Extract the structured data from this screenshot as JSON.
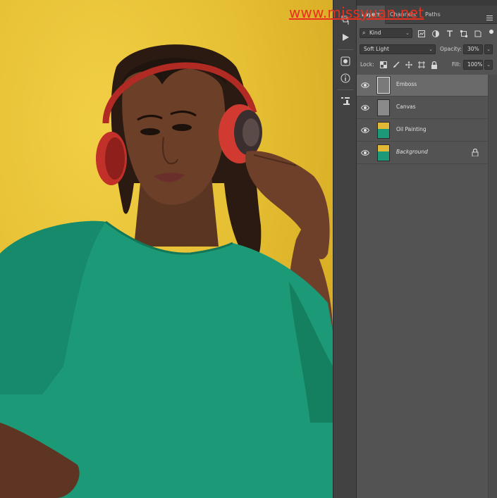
{
  "watermark": "www.missyuan.net",
  "tabs": {
    "layers": "Layers",
    "channels": "Channels",
    "paths": "Paths"
  },
  "filter": {
    "kind_label": "Kind"
  },
  "blend": {
    "mode": "Soft Light",
    "opacity_label": "Opacity:",
    "opacity_value": "30%"
  },
  "lock": {
    "label": "Lock:",
    "fill_label": "Fill:",
    "fill_value": "100%"
  },
  "layers": [
    {
      "name": "Emboss",
      "selected": true,
      "thumb": "gray-bordered"
    },
    {
      "name": "Canvas",
      "selected": false,
      "thumb": "gray"
    },
    {
      "name": "Oil Painting",
      "selected": false,
      "thumb": "photo"
    },
    {
      "name": "Background",
      "selected": false,
      "thumb": "photo",
      "italic": true,
      "locked": true
    }
  ],
  "icons": {
    "filter": "search-icon",
    "visibility": "eye-icon",
    "lock": "lock-icon",
    "menu": "hamburger-menu-icon"
  },
  "colors": {
    "panel_bg": "#535353",
    "tab_bar_bg": "#424242",
    "selected_layer": "#6a6a6a",
    "canvas_bg": "#e6bf33",
    "watermark": "#e8301f"
  }
}
